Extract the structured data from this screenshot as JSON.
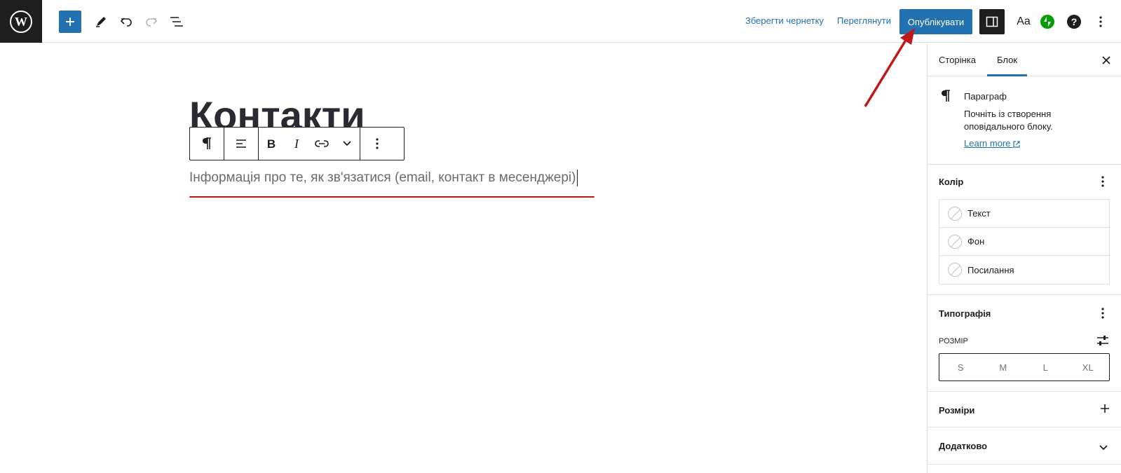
{
  "header": {
    "save_draft": "Зберегти чернетку",
    "preview": "Переглянути",
    "publish": "Опублікувати",
    "styles_label": "Aa"
  },
  "editor": {
    "title": "Контакти",
    "paragraph": "Інформація про те, як зв'язатися (email, контакт в месенджері)"
  },
  "sidebar": {
    "tabs": [
      "Сторінка",
      "Блок"
    ],
    "active_tab": "Блок",
    "block": {
      "name": "Параграф",
      "description": "Почніть із створення оповідального блоку.",
      "learn_more": "Learn more"
    },
    "color": {
      "title": "Колір",
      "items": [
        "Текст",
        "Фон",
        "Посилання"
      ]
    },
    "typography": {
      "title": "Типографія",
      "size_label": "РОЗМІР",
      "sizes": [
        "S",
        "M",
        "L",
        "XL"
      ]
    },
    "dimensions": {
      "title": "Розміри"
    },
    "advanced": {
      "title": "Додатково"
    }
  },
  "colors": {
    "accent": "#2271b1",
    "dark": "#1e1e1e",
    "annotation_red": "#c01818",
    "jetpack_green": "#069e08"
  }
}
